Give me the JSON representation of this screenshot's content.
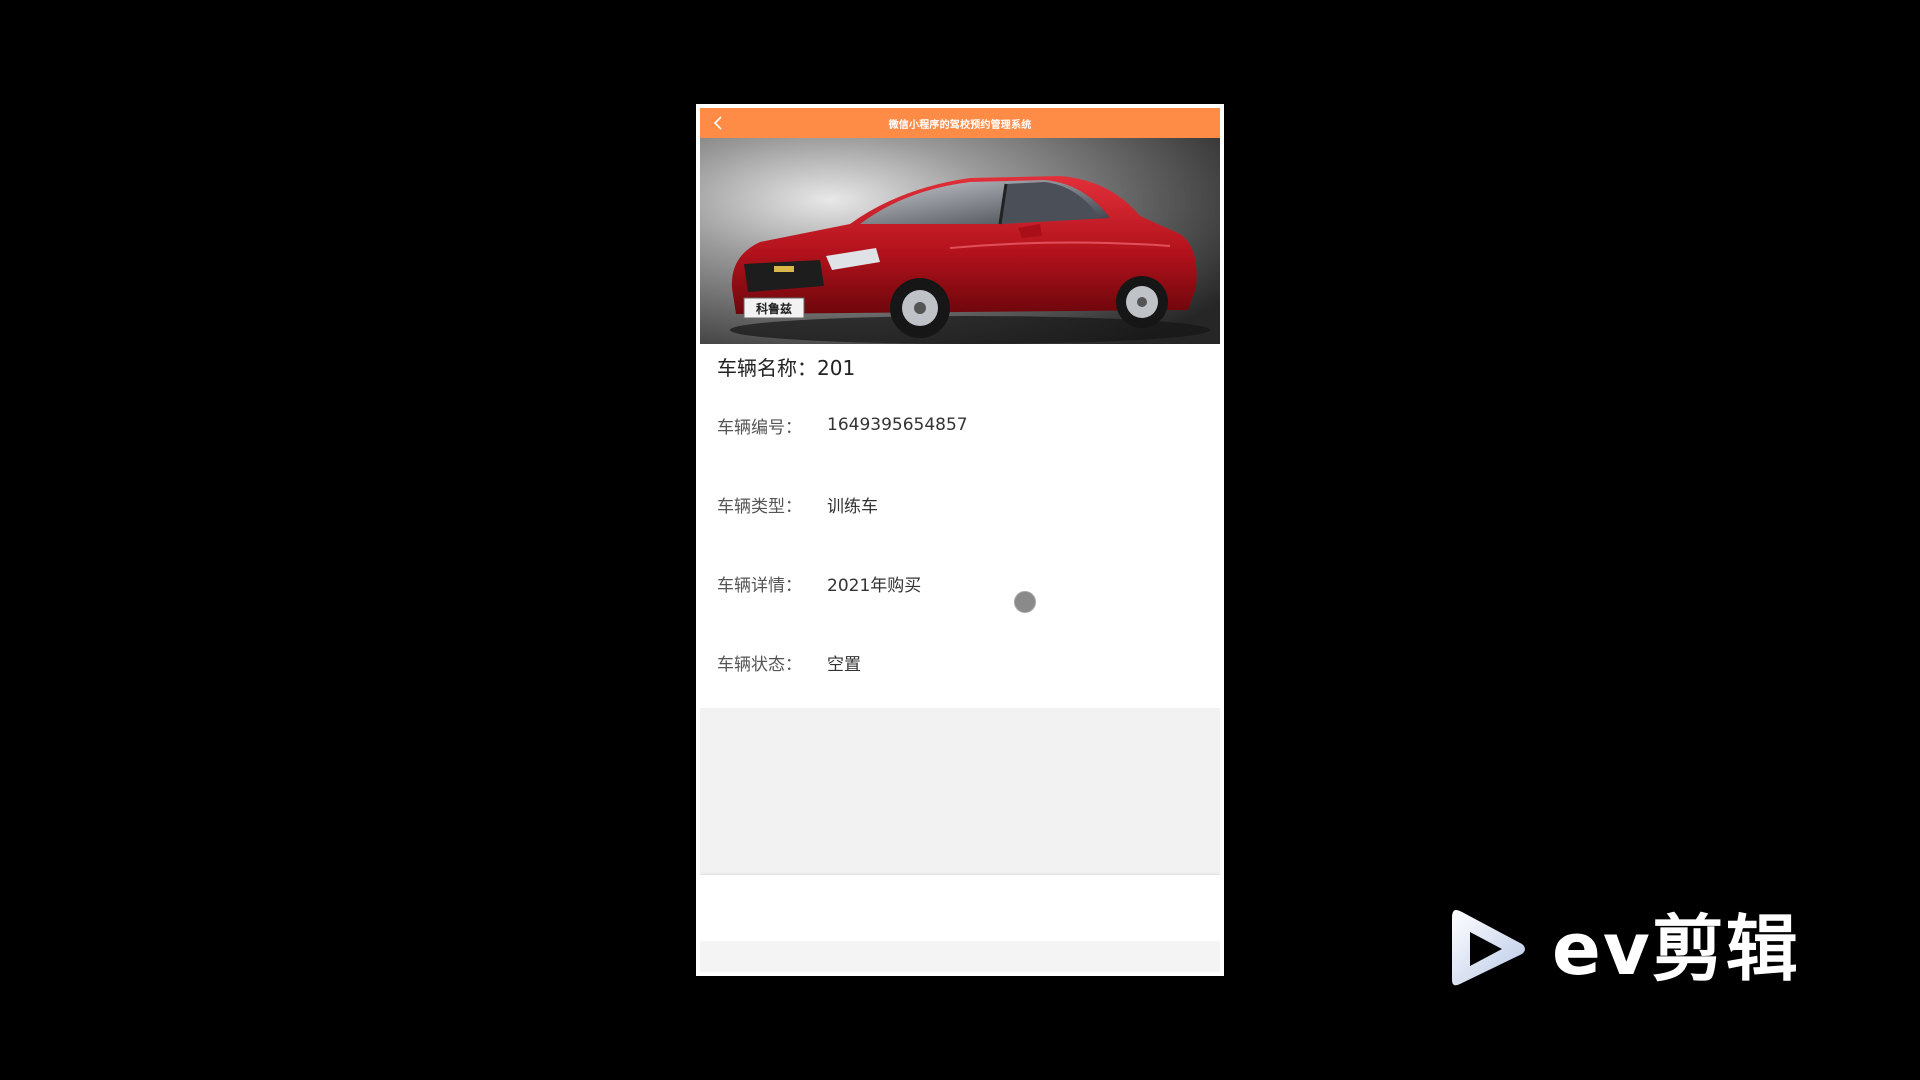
{
  "navbar": {
    "title": "微信小程序的驾校预约管理系统",
    "background": "#ff8c46"
  },
  "vehicle": {
    "name_label": "车辆名称：",
    "name_value": "201",
    "fields": [
      {
        "label": "车辆编号：",
        "value": "1649395654857"
      },
      {
        "label": "车辆类型：",
        "value": "训练车"
      },
      {
        "label": "车辆详情：",
        "value": "2021年购买"
      },
      {
        "label": "车辆状态：",
        "value": "空置"
      }
    ],
    "image_plate_text": "科鲁兹"
  },
  "watermark": {
    "text": "ev剪辑"
  },
  "icons": {
    "back": "chevron-left-icon",
    "play": "play-logo-icon"
  }
}
